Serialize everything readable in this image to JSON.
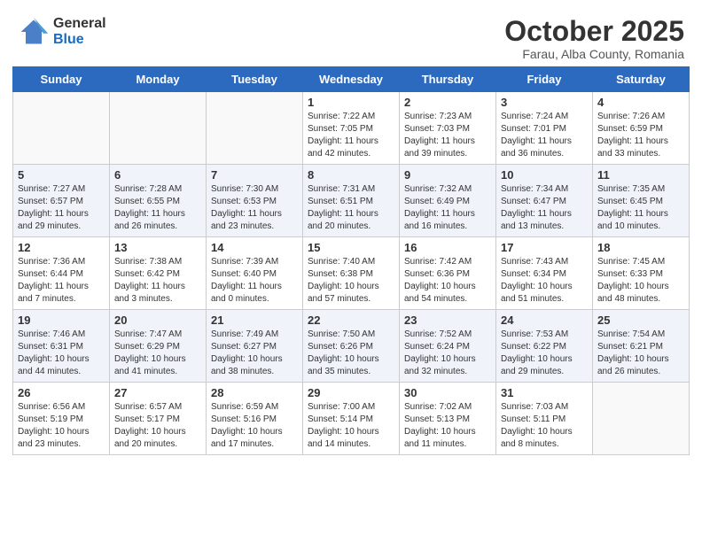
{
  "header": {
    "logo_general": "General",
    "logo_blue": "Blue",
    "month_title": "October 2025",
    "subtitle": "Farau, Alba County, Romania"
  },
  "days_of_week": [
    "Sunday",
    "Monday",
    "Tuesday",
    "Wednesday",
    "Thursday",
    "Friday",
    "Saturday"
  ],
  "weeks": [
    [
      {
        "day": "",
        "info": ""
      },
      {
        "day": "",
        "info": ""
      },
      {
        "day": "",
        "info": ""
      },
      {
        "day": "1",
        "info": "Sunrise: 7:22 AM\nSunset: 7:05 PM\nDaylight: 11 hours and 42 minutes."
      },
      {
        "day": "2",
        "info": "Sunrise: 7:23 AM\nSunset: 7:03 PM\nDaylight: 11 hours and 39 minutes."
      },
      {
        "day": "3",
        "info": "Sunrise: 7:24 AM\nSunset: 7:01 PM\nDaylight: 11 hours and 36 minutes."
      },
      {
        "day": "4",
        "info": "Sunrise: 7:26 AM\nSunset: 6:59 PM\nDaylight: 11 hours and 33 minutes."
      }
    ],
    [
      {
        "day": "5",
        "info": "Sunrise: 7:27 AM\nSunset: 6:57 PM\nDaylight: 11 hours and 29 minutes."
      },
      {
        "day": "6",
        "info": "Sunrise: 7:28 AM\nSunset: 6:55 PM\nDaylight: 11 hours and 26 minutes."
      },
      {
        "day": "7",
        "info": "Sunrise: 7:30 AM\nSunset: 6:53 PM\nDaylight: 11 hours and 23 minutes."
      },
      {
        "day": "8",
        "info": "Sunrise: 7:31 AM\nSunset: 6:51 PM\nDaylight: 11 hours and 20 minutes."
      },
      {
        "day": "9",
        "info": "Sunrise: 7:32 AM\nSunset: 6:49 PM\nDaylight: 11 hours and 16 minutes."
      },
      {
        "day": "10",
        "info": "Sunrise: 7:34 AM\nSunset: 6:47 PM\nDaylight: 11 hours and 13 minutes."
      },
      {
        "day": "11",
        "info": "Sunrise: 7:35 AM\nSunset: 6:45 PM\nDaylight: 11 hours and 10 minutes."
      }
    ],
    [
      {
        "day": "12",
        "info": "Sunrise: 7:36 AM\nSunset: 6:44 PM\nDaylight: 11 hours and 7 minutes."
      },
      {
        "day": "13",
        "info": "Sunrise: 7:38 AM\nSunset: 6:42 PM\nDaylight: 11 hours and 3 minutes."
      },
      {
        "day": "14",
        "info": "Sunrise: 7:39 AM\nSunset: 6:40 PM\nDaylight: 11 hours and 0 minutes."
      },
      {
        "day": "15",
        "info": "Sunrise: 7:40 AM\nSunset: 6:38 PM\nDaylight: 10 hours and 57 minutes."
      },
      {
        "day": "16",
        "info": "Sunrise: 7:42 AM\nSunset: 6:36 PM\nDaylight: 10 hours and 54 minutes."
      },
      {
        "day": "17",
        "info": "Sunrise: 7:43 AM\nSunset: 6:34 PM\nDaylight: 10 hours and 51 minutes."
      },
      {
        "day": "18",
        "info": "Sunrise: 7:45 AM\nSunset: 6:33 PM\nDaylight: 10 hours and 48 minutes."
      }
    ],
    [
      {
        "day": "19",
        "info": "Sunrise: 7:46 AM\nSunset: 6:31 PM\nDaylight: 10 hours and 44 minutes."
      },
      {
        "day": "20",
        "info": "Sunrise: 7:47 AM\nSunset: 6:29 PM\nDaylight: 10 hours and 41 minutes."
      },
      {
        "day": "21",
        "info": "Sunrise: 7:49 AM\nSunset: 6:27 PM\nDaylight: 10 hours and 38 minutes."
      },
      {
        "day": "22",
        "info": "Sunrise: 7:50 AM\nSunset: 6:26 PM\nDaylight: 10 hours and 35 minutes."
      },
      {
        "day": "23",
        "info": "Sunrise: 7:52 AM\nSunset: 6:24 PM\nDaylight: 10 hours and 32 minutes."
      },
      {
        "day": "24",
        "info": "Sunrise: 7:53 AM\nSunset: 6:22 PM\nDaylight: 10 hours and 29 minutes."
      },
      {
        "day": "25",
        "info": "Sunrise: 7:54 AM\nSunset: 6:21 PM\nDaylight: 10 hours and 26 minutes."
      }
    ],
    [
      {
        "day": "26",
        "info": "Sunrise: 6:56 AM\nSunset: 5:19 PM\nDaylight: 10 hours and 23 minutes."
      },
      {
        "day": "27",
        "info": "Sunrise: 6:57 AM\nSunset: 5:17 PM\nDaylight: 10 hours and 20 minutes."
      },
      {
        "day": "28",
        "info": "Sunrise: 6:59 AM\nSunset: 5:16 PM\nDaylight: 10 hours and 17 minutes."
      },
      {
        "day": "29",
        "info": "Sunrise: 7:00 AM\nSunset: 5:14 PM\nDaylight: 10 hours and 14 minutes."
      },
      {
        "day": "30",
        "info": "Sunrise: 7:02 AM\nSunset: 5:13 PM\nDaylight: 10 hours and 11 minutes."
      },
      {
        "day": "31",
        "info": "Sunrise: 7:03 AM\nSunset: 5:11 PM\nDaylight: 10 hours and 8 minutes."
      },
      {
        "day": "",
        "info": ""
      }
    ]
  ]
}
